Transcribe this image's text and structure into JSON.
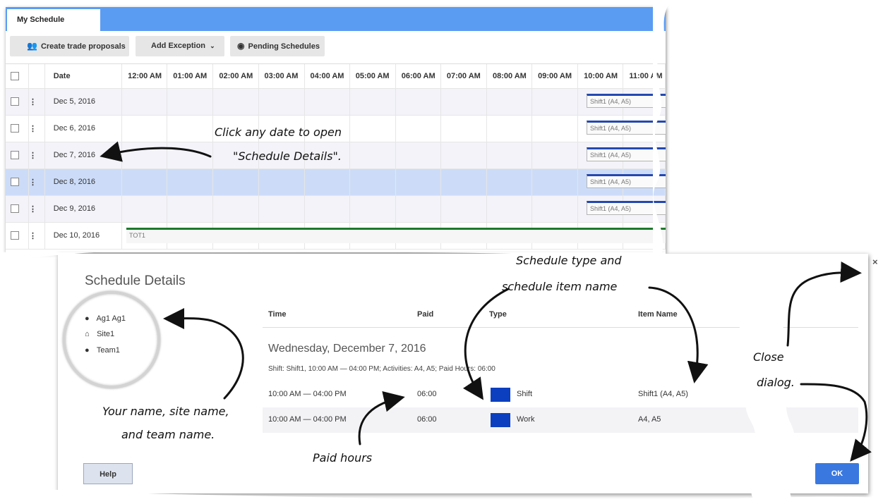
{
  "window": {
    "tab": "My Schedule"
  },
  "toolbar": {
    "trade_label": "Create trade proposals",
    "exception_label": "Add Exception",
    "pending_label": "Pending Schedules"
  },
  "grid": {
    "date_header": "Date",
    "hours": [
      "12:00 AM",
      "01:00 AM",
      "02:00 AM",
      "03:00 AM",
      "04:00 AM",
      "05:00 AM",
      "06:00 AM",
      "07:00 AM",
      "08:00 AM",
      "09:00 AM",
      "10:00 AM",
      "11:00 AM"
    ],
    "rows": [
      {
        "date": "Dec 5, 2016",
        "shift": "Shift1 (A4, A5)"
      },
      {
        "date": "Dec 6, 2016",
        "shift": "Shift1 (A4, A5)"
      },
      {
        "date": "Dec 7, 2016",
        "shift": "Shift1 (A4, A5)"
      },
      {
        "date": "Dec 8, 2016",
        "shift": "Shift1 (A4, A5)"
      },
      {
        "date": "Dec 9, 2016",
        "shift": "Shift1 (A4, A5)"
      },
      {
        "date": "Dec 10, 2016",
        "shift": "TOT1"
      }
    ]
  },
  "dialog": {
    "title": "Schedule Details",
    "agent": {
      "name": "Ag1 Ag1",
      "site": "Site1",
      "team": "Team1"
    },
    "columns": {
      "time": "Time",
      "paid": "Paid",
      "type": "Type",
      "item": "Item Name"
    },
    "day_title": "Wednesday, December 7, 2016",
    "day_summary": "Shift: Shift1, 10:00 AM — 04:00 PM; Activities: A4, A5; Paid Hours: 06:00",
    "rows": [
      {
        "time": "10:00 AM — 04:00 PM",
        "paid": "06:00",
        "type": "Shift",
        "item": "Shift1 (A4, A5)"
      },
      {
        "time": "10:00 AM — 04:00 PM",
        "paid": "06:00",
        "type": "Work",
        "item": "A4, A5"
      }
    ],
    "help_label": "Help",
    "ok_label": "OK",
    "close_symbol": "×"
  },
  "annotations": {
    "click_date_1": "Click any date to open",
    "click_date_2": "\"Schedule Details\".",
    "schedule_type_1": "Schedule type and",
    "schedule_type_2": "schedule item name",
    "your_name_1": "Your name, site name,",
    "your_name_2": "and team name.",
    "paid_hours": "Paid hours",
    "close_1": "Close",
    "close_2": "dialog."
  },
  "colors": {
    "tabbar": "#5b9cf3",
    "selected_row": "#ccdcf8",
    "shift_bar": "#2448b0",
    "tot_bar": "#1d7a2c",
    "activity_swatch": "#0b3fc0",
    "ok_button": "#3a78e0"
  }
}
